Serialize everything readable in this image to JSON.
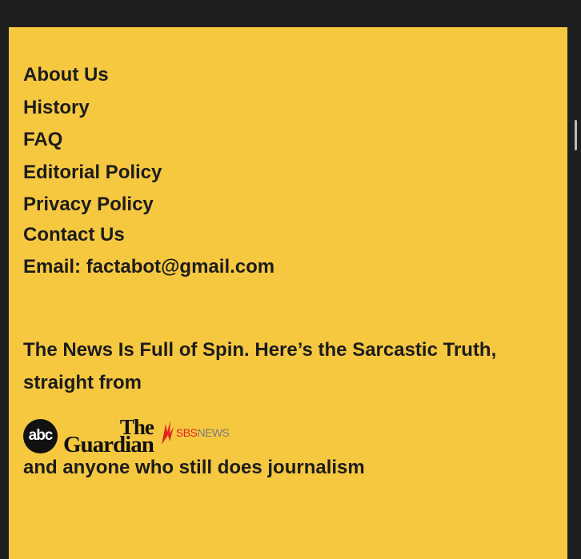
{
  "nav": {
    "items": [
      {
        "label": "About Us"
      },
      {
        "label": "History"
      },
      {
        "label": "FAQ"
      },
      {
        "label": "Editorial Policy"
      },
      {
        "label": "Privacy Policy"
      },
      {
        "label": "Contact Us"
      }
    ]
  },
  "contact": {
    "email_label": "Email: factabot@gmail.com"
  },
  "tagline": {
    "text": "The News Is Full of Spin. Here’s the Sarcastic Truth, straight from"
  },
  "logos": {
    "abc": "abc",
    "guardian_line1": "The",
    "guardian_line2": "Guardian",
    "sbs": "SBS",
    "sbs_news": "NEWS"
  },
  "closing": {
    "text": "and anyone who still does journalism"
  },
  "colors": {
    "panel_bg": "#f6c840",
    "frame_bg": "#1f1f1f",
    "text": "#1c1c1c",
    "sbs_red": "#e1251b"
  }
}
